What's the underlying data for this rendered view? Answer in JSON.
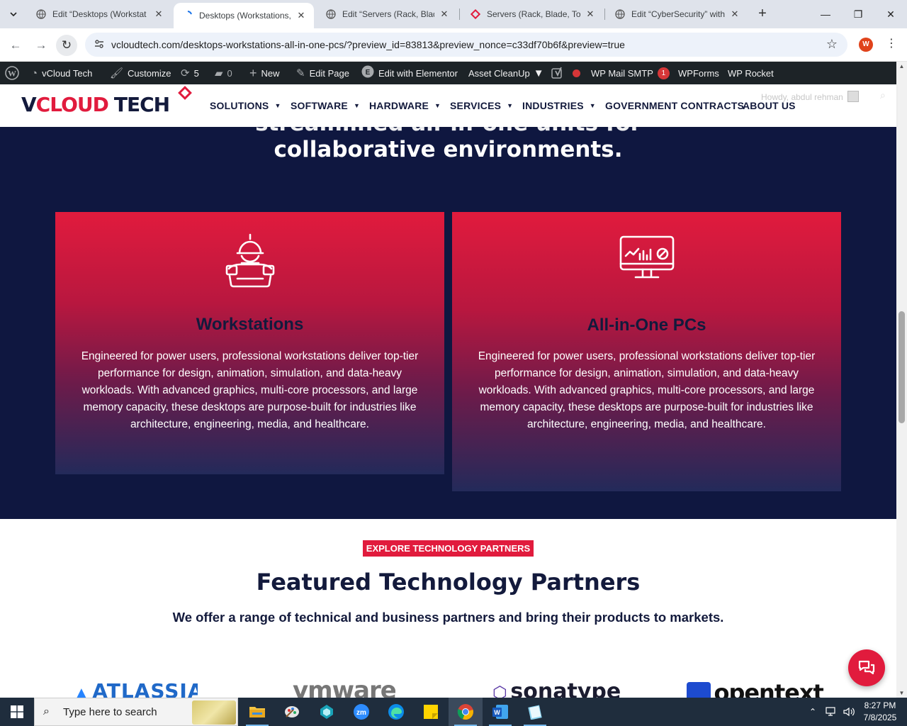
{
  "browser": {
    "tabs": [
      {
        "title": "Edit “Desktops (Workstat",
        "active": false
      },
      {
        "title": "Desktops (Workstations, ",
        "active": true
      },
      {
        "title": "Edit “Servers (Rack, Blade",
        "active": false
      },
      {
        "title": "Servers (Rack, Blade, Tow",
        "active": false
      },
      {
        "title": "Edit “CyberSecurity” with",
        "active": false
      }
    ],
    "url": "vcloudtech.com/desktops-workstations-all-in-one-pcs/?preview_id=83813&preview_nonce=c33df70b6f&preview=true",
    "profile_initial": "W"
  },
  "adminbar": {
    "site_name": "vCloud Tech",
    "customize": "Customize",
    "updates_count": "5",
    "comments_count": "0",
    "new": "New",
    "edit_page": "Edit Page",
    "edit_elementor": "Edit with Elementor",
    "asset_cleanup": "Asset CleanUp",
    "wp_mail_smtp": "WP Mail SMTP",
    "wp_mail_smtp_badge": "1",
    "wpforms": "WPForms",
    "wp_rocket": "WP Rocket"
  },
  "site": {
    "logo_v": "V",
    "logo_cloud": "CLOUD",
    "logo_tech": "TECH",
    "menu": [
      "SOLUTIONS",
      "SOFTWARE",
      "HARDWARE",
      "SERVICES",
      "INDUSTRIES",
      "GOVERNMENT CONTRACTS",
      "ABOUT US"
    ],
    "howdy": "Howdy, abdul rehman"
  },
  "hero": {
    "heading_line1": "streamlined all-in-one units for",
    "heading_line2": "collaborative environments."
  },
  "cards": [
    {
      "title": "Workstations",
      "icon": "engineer-workstation-icon",
      "text": "Engineered for power users, professional workstations deliver top-tier performance for design, animation, simulation, and data-heavy workloads. With advanced graphics, multi-core processors, and large memory capacity, these desktops are purpose-built for industries like architecture, engineering, media, and healthcare."
    },
    {
      "title": "All-in-One PCs",
      "icon": "monitor-analytics-icon",
      "text": "Engineered for power users, professional workstations deliver top-tier performance for design, animation, simulation, and data-heavy workloads. With advanced graphics, multi-core processors, and large memory capacity, these desktops are purpose-built for industries like architecture, engineering, media, and healthcare."
    }
  ],
  "partners": {
    "badge": "EXPLORE TECHNOLOGY PARTNERS",
    "title": "Featured Technology Partners",
    "subtitle": "We offer a range of technical and business partners and bring their products to markets.",
    "logos": [
      "ATLASSIAN",
      "vmware",
      "sonatype",
      "opentext"
    ]
  },
  "taskbar": {
    "search_placeholder": "Type here to search",
    "time": "8:27 PM",
    "date": "7/8/2025"
  },
  "colors": {
    "brand_red": "#e11b3d",
    "navy": "#0f1740",
    "dark_text": "#131a3c"
  }
}
